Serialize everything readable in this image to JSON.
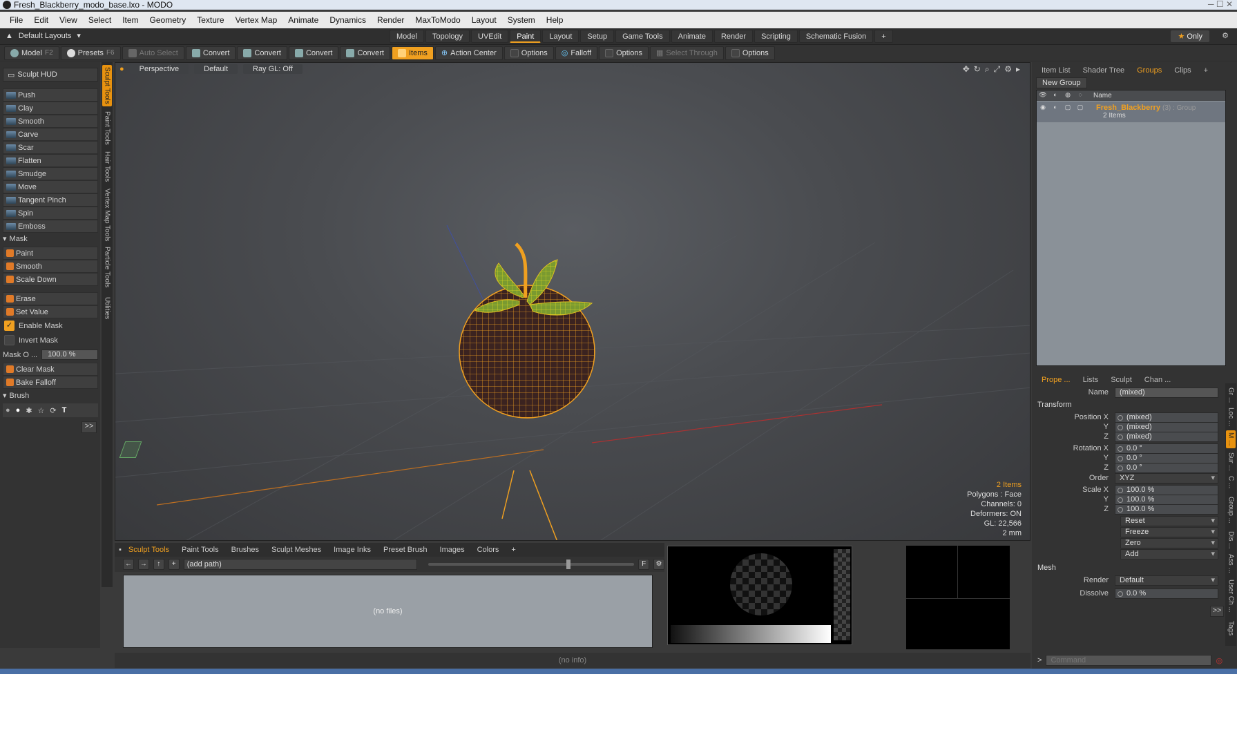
{
  "window": {
    "title": "Fresh_Blackberry_modo_base.lxo - MODO"
  },
  "menu": [
    "File",
    "Edit",
    "View",
    "Select",
    "Item",
    "Geometry",
    "Texture",
    "Vertex Map",
    "Animate",
    "Dynamics",
    "Render",
    "MaxToModo",
    "Layout",
    "System",
    "Help"
  ],
  "layout": {
    "default_layouts": "Default Layouts",
    "tabs": [
      "Model",
      "Topology",
      "UVEdit",
      "Paint",
      "Layout",
      "Setup",
      "Game Tools",
      "Animate",
      "Render",
      "Scripting",
      "Schematic Fusion"
    ],
    "active_tab": "Paint",
    "only_label": "Only"
  },
  "toolbar": {
    "model": "Model",
    "model_key": "F2",
    "presets": "Presets",
    "presets_key": "F6",
    "auto_select": "Auto Select",
    "convert": "Convert",
    "items": "Items",
    "action_center": "Action Center",
    "options": "Options",
    "falloff": "Falloff",
    "select_through": "Select Through"
  },
  "left": {
    "sculpt_hud": "Sculpt HUD",
    "tools": [
      "Push",
      "Clay",
      "Smooth",
      "Carve",
      "Scar",
      "Flatten",
      "Smudge",
      "Move",
      "Tangent Pinch",
      "Spin",
      "Emboss"
    ],
    "mask_header": "Mask",
    "mask_tools": [
      "Paint",
      "Smooth",
      "Scale Down"
    ],
    "erase": "Erase",
    "set_value": "Set Value",
    "enable_mask": "Enable Mask",
    "invert_mask": "Invert Mask",
    "mask_opacity_label": "Mask O ...",
    "mask_opacity_value": "100.0 %",
    "clear_mask": "Clear Mask",
    "bake_falloff": "Bake Falloff",
    "brush_header": "Brush",
    "more": ">>",
    "side_tabs": [
      "Sculpt Tools",
      "Paint Tools",
      "Hair Tools",
      "Vertex Map Tools",
      "Particle Tools",
      "Utilities"
    ]
  },
  "viewport": {
    "perspective": "Perspective",
    "default": "Default",
    "raygl": "Ray GL: Off",
    "info": {
      "items": "2 Items",
      "polygons": "Polygons : Face",
      "channels": "Channels: 0",
      "deformers": "Deformers: ON",
      "gl": "GL: 22,566",
      "scale": "2 mm"
    }
  },
  "browser": {
    "tabs": [
      "Sculpt Tools",
      "Paint Tools",
      "Brushes",
      "Sculpt Meshes",
      "Image Inks",
      "Preset Brush",
      "Images",
      "Colors"
    ],
    "path": "(add path)",
    "empty": "(no files)",
    "status": "(no info)"
  },
  "right": {
    "tabs": [
      "Item List",
      "Shader Tree",
      "Groups",
      "Clips"
    ],
    "active_tab": "Groups",
    "new_group": "New Group",
    "col_name": "Name",
    "group_name": "Fresh_Blackberry",
    "group_meta": "(3) : Group",
    "group_items": "2 Items",
    "prop_tabs": [
      "Prope ...",
      "Lists",
      "Sculpt",
      "Chan ..."
    ],
    "name_label": "Name",
    "name_value": "(mixed)",
    "transform": "Transform",
    "position_label": "Position X",
    "pos": [
      "(mixed)",
      "(mixed)",
      "(mixed)"
    ],
    "rotation_label": "Rotation X",
    "rot": [
      "0.0 °",
      "0.0 °",
      "0.0 °"
    ],
    "order_label": "Order",
    "order_value": "XYZ",
    "scale_label": "Scale X",
    "scale": [
      "100.0 %",
      "100.0 %",
      "100.0 %"
    ],
    "y": "Y",
    "z": "Z",
    "actions": [
      "Reset",
      "Freeze",
      "Zero",
      "Add"
    ],
    "mesh": "Mesh",
    "render_label": "Render",
    "render_value": "Default",
    "dissolve_label": "Dissolve",
    "dissolve_value": "0.0 %",
    "command_placeholder": "Command",
    "side_tabs": [
      "Gr ...",
      "Loc ...",
      "M ...",
      "Sur ...",
      "C ...",
      "Group ...",
      "Dis ...",
      "Ass ...",
      "User Ch ...",
      "Tags"
    ]
  }
}
